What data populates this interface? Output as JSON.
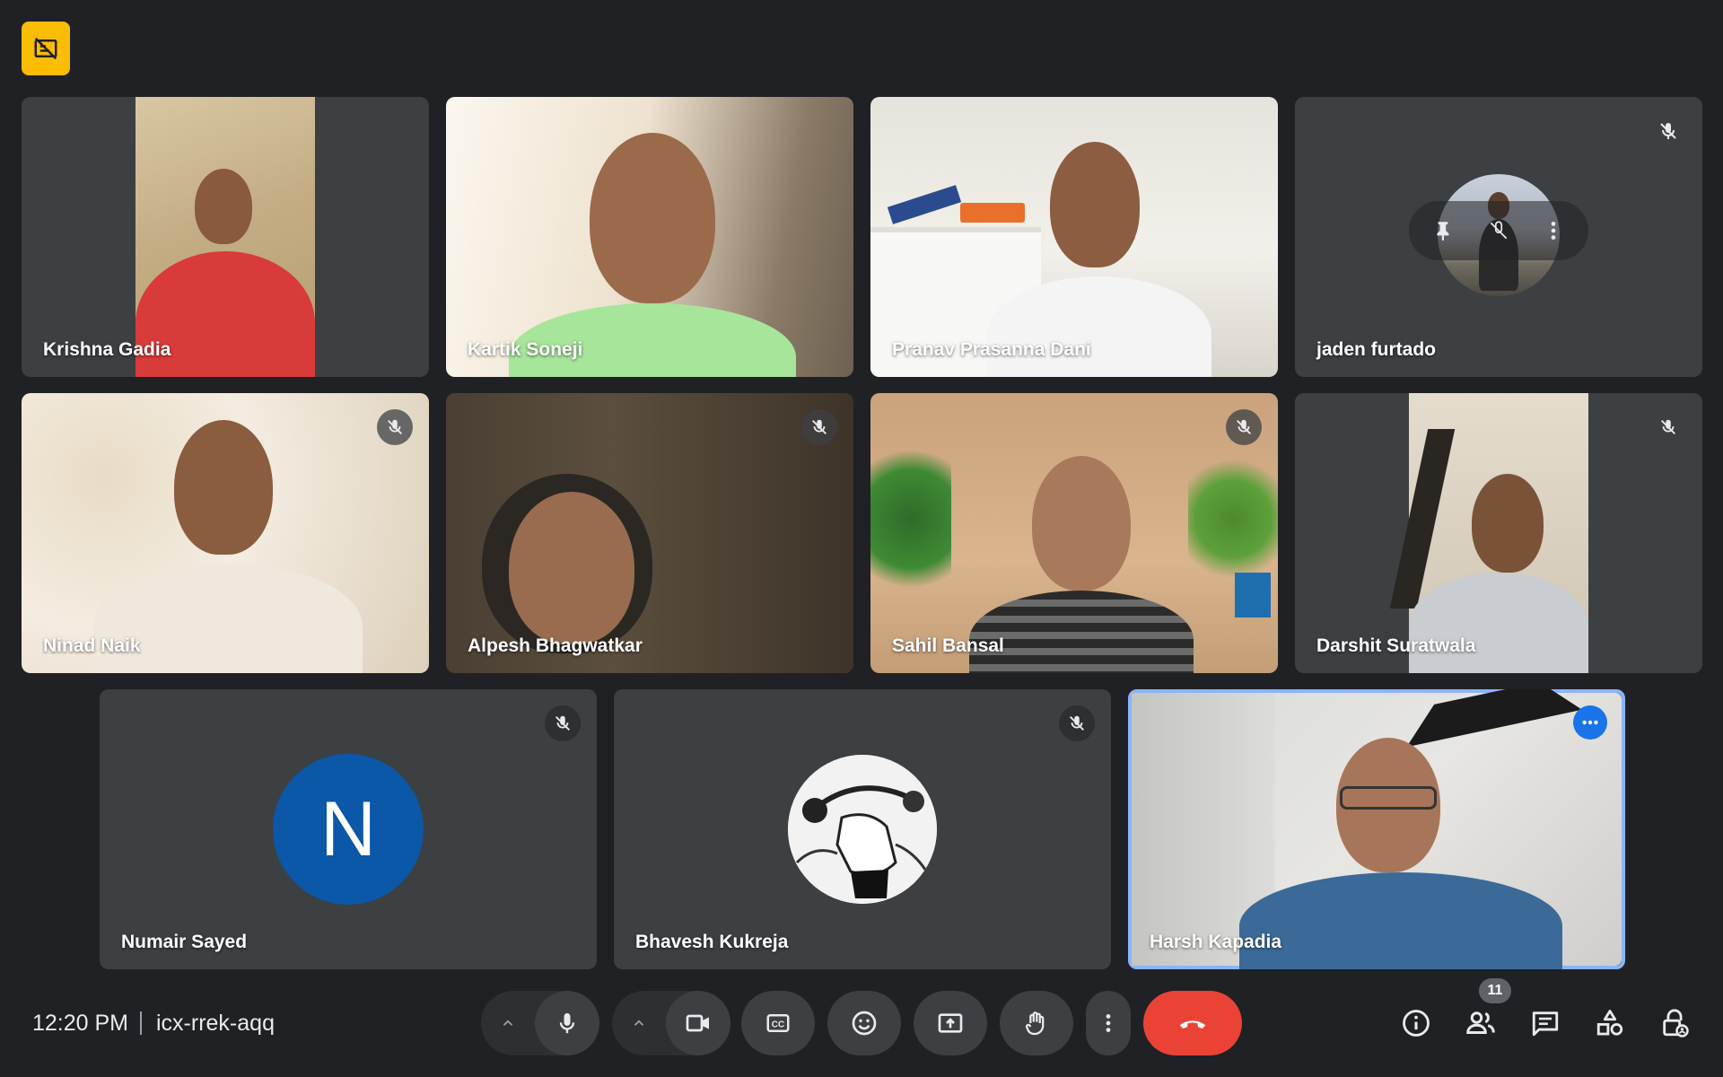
{
  "meeting": {
    "time": "12:20 PM",
    "code": "icx-rrek-aqq",
    "participant_count": "11"
  },
  "participants": [
    {
      "name": "Krishna Gadia",
      "muted": false
    },
    {
      "name": "Kartik Soneji",
      "muted": false
    },
    {
      "name": "Pranav Prasanna Dani",
      "muted": false
    },
    {
      "name": "jaden furtado",
      "muted": true
    },
    {
      "name": "Ninad Naik",
      "muted": true
    },
    {
      "name": "Alpesh Bhagwatkar",
      "muted": true
    },
    {
      "name": "Sahil Bansal",
      "muted": true
    },
    {
      "name": "Darshit Suratwala",
      "muted": true
    },
    {
      "name": "Numair Sayed",
      "muted": true,
      "avatar_letter": "N"
    },
    {
      "name": "Bhavesh Kukreja",
      "muted": true
    },
    {
      "name": "Harsh Kapadia",
      "muted": false,
      "self": true
    }
  ],
  "colors": {
    "background": "#202124",
    "tile": "#3c4043",
    "end_call": "#ea4335",
    "active_outline": "#8ab4f8",
    "badge": "#fbbc04"
  }
}
